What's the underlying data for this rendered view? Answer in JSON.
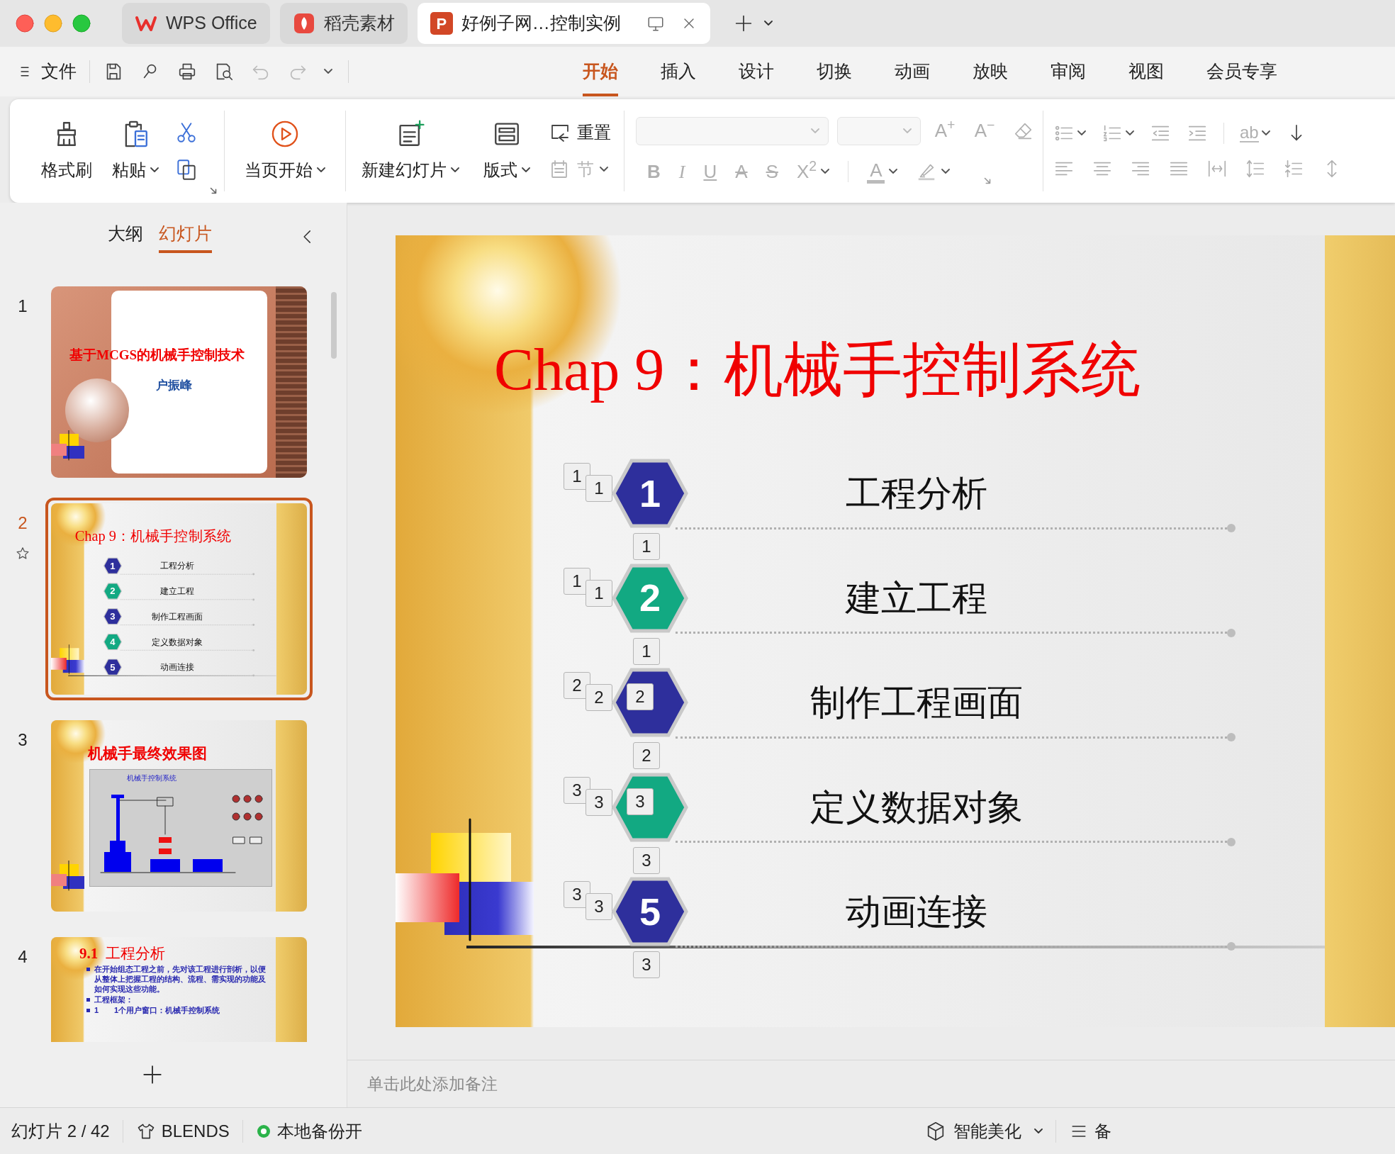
{
  "tabs": [
    {
      "label": "WPS Office",
      "kind": "home",
      "selected": false
    },
    {
      "label": "稻壳素材",
      "kind": "docer",
      "selected": false
    },
    {
      "label": "好例子网…控制实例",
      "kind": "document",
      "badge": "P",
      "selected": true
    }
  ],
  "file_menu": "文件",
  "ribbon_tabs": [
    {
      "label": "开始",
      "selected": true
    },
    {
      "label": "插入",
      "selected": false
    },
    {
      "label": "设计",
      "selected": false
    },
    {
      "label": "切换",
      "selected": false
    },
    {
      "label": "动画",
      "selected": false
    },
    {
      "label": "放映",
      "selected": false
    },
    {
      "label": "审阅",
      "selected": false
    },
    {
      "label": "视图",
      "selected": false
    },
    {
      "label": "会员专享",
      "selected": false
    }
  ],
  "ribbon": {
    "format_painter": "格式刷",
    "paste": "粘贴",
    "start_current": "当页开始",
    "new_slide": "新建幻灯片",
    "layout": "版式",
    "reset": "重置",
    "section": {
      "label": "节",
      "disabled": true
    },
    "font_size_buttons": [
      {
        "glyph": "A$^{+}$",
        "disabled": true
      },
      {
        "glyph": "A$^{−}$",
        "disabled": true
      }
    ],
    "text_format": [
      {
        "glyph": "B",
        "kind": "bold",
        "disabled": true
      },
      {
        "glyph": "I",
        "kind": "italic",
        "disabled": true
      },
      {
        "glyph": "U",
        "kind": "underline",
        "disabled": true
      },
      {
        "glyph": "A",
        "kind": "strike",
        "disabled": true
      },
      {
        "glyph": "S",
        "kind": "strike",
        "disabled": true
      },
      {
        "glyph": "X$^{2}$",
        "kind": "superscript",
        "disabled": true
      }
    ],
    "font_color": {
      "glyph": "A",
      "disabled": true
    },
    "text_direction": {
      "glyph": "ab",
      "disabled": true
    }
  },
  "panel_tabs": [
    {
      "label": "大纲",
      "selected": false
    },
    {
      "label": "幻灯片",
      "selected": true
    }
  ],
  "thumbnails": [
    {
      "number": "1",
      "selected": false,
      "kind": "title",
      "title": "基于MCGS的机械手控制技术",
      "subtitle": "户振峰"
    },
    {
      "number": "2",
      "selected": true,
      "kind": "agenda",
      "title": "Chap 9：机械手控制系统",
      "items": [
        {
          "label": "工程分析",
          "number": "1",
          "color": "#2e2f9c"
        },
        {
          "label": "建立工程",
          "number": "2",
          "color": "#12a982"
        },
        {
          "label": "制作工程画面",
          "number": "3",
          "color": "#2e2f9c"
        },
        {
          "label": "定义数据对象",
          "number": "4",
          "color": "#12a982"
        },
        {
          "label": "动画连接",
          "number": "5",
          "color": "#2e2f9c"
        }
      ]
    },
    {
      "number": "3",
      "selected": false,
      "kind": "figure",
      "title": "机械手最终效果图",
      "figure_title": "机械手控制系统"
    },
    {
      "number": "4",
      "selected": false,
      "kind": "bullets",
      "title": "**9.1**  工程分析",
      "bullets": [
        "在开始组态工程之前，先对该工程进行剖析，以便从整体上把握工程的结构、流程、需实现的功能及如何实现这些功能。",
        "工程框架：",
        "1　　1个用户窗口：机械手控制系统"
      ]
    }
  ],
  "slide": {
    "title": "Chap 9：机械手控制系统",
    "items": [
      {
        "label": "工程分析",
        "number": "1",
        "color": "#2e2f9c",
        "markers": [
          {
            "text": "1",
            "kind": "left_back"
          },
          {
            "text": "1",
            "kind": "left_front"
          },
          {
            "text": "1",
            "kind": "below"
          }
        ]
      },
      {
        "label": "建立工程",
        "number": "2",
        "color": "#12a982",
        "markers": [
          {
            "text": "1",
            "kind": "left_back"
          },
          {
            "text": "1",
            "kind": "left_front"
          },
          {
            "text": "1",
            "kind": "below"
          }
        ]
      },
      {
        "label": "制作工程画面",
        "color": "#2e2f9c",
        "markers": [
          {
            "text": "2",
            "kind": "left_back"
          },
          {
            "text": "2",
            "kind": "left_front"
          },
          {
            "text": "2",
            "kind": "on_hex"
          },
          {
            "text": "2",
            "kind": "below"
          }
        ]
      },
      {
        "label": "定义数据对象",
        "color": "#12a982",
        "markers": [
          {
            "text": "3",
            "kind": "left_back"
          },
          {
            "text": "3",
            "kind": "left_front"
          },
          {
            "text": "3",
            "kind": "on_hex"
          },
          {
            "text": "3",
            "kind": "below"
          }
        ]
      },
      {
        "label": "动画连接",
        "number": "5",
        "color": "#2e2f9c",
        "markers": [
          {
            "text": "3",
            "kind": "left_back"
          },
          {
            "text": "3",
            "kind": "left_front"
          },
          {
            "text": "3",
            "kind": "below"
          }
        ]
      }
    ]
  },
  "notes_placeholder": "单击此处添加备注",
  "status_bar": {
    "slide_counter": "幻灯片 2 / 42",
    "theme": "BLENDS",
    "backup": "本地备份开",
    "beautify": "智能美化",
    "notes": "备"
  }
}
